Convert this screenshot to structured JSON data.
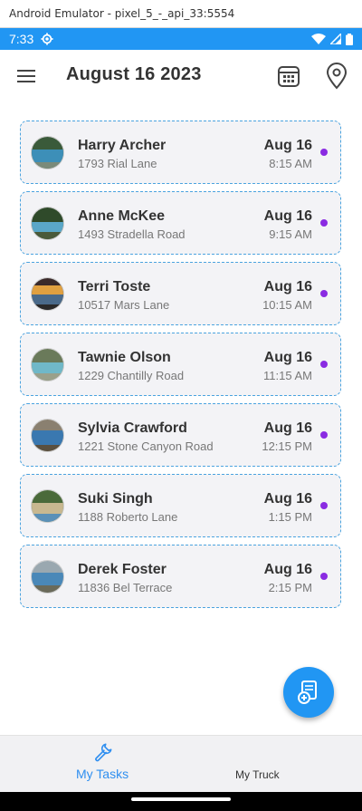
{
  "window": {
    "title": "Android Emulator - pixel_5_-_api_33:5554"
  },
  "status_bar": {
    "time": "7:33",
    "color": "#2196f3"
  },
  "app_bar": {
    "title": "August 16 2023",
    "icons": [
      "menu-icon",
      "calendar-icon",
      "location-pin-icon"
    ]
  },
  "tasks": [
    {
      "name": "Harry Archer",
      "address": "1793 Rial Lane",
      "date": "Aug 16",
      "time": "8:15 AM"
    },
    {
      "name": "Anne McKee",
      "address": "1493 Stradella Road",
      "date": "Aug 16",
      "time": "9:15 AM"
    },
    {
      "name": "Terri Toste",
      "address": "10517 Mars Lane",
      "date": "Aug 16",
      "time": "10:15 AM"
    },
    {
      "name": "Tawnie Olson",
      "address": "1229 Chantilly Road",
      "date": "Aug 16",
      "time": "11:15 AM"
    },
    {
      "name": "Sylvia Crawford",
      "address": "1221 Stone Canyon Road",
      "date": "Aug 16",
      "time": "12:15 PM"
    },
    {
      "name": "Suki Singh",
      "address": "1188 Roberto Lane",
      "date": "Aug 16",
      "time": "1:15 PM"
    },
    {
      "name": "Derek Foster",
      "address": "11836 Bel Terrace",
      "date": "Aug 16",
      "time": "2:15 PM"
    }
  ],
  "status_dot_color": "#8a2be2",
  "fab": {
    "icon": "new-task-icon"
  },
  "bottom_nav": {
    "tabs": [
      {
        "label": "My Tasks",
        "icon": "wrench-icon",
        "active": true
      },
      {
        "label": "My Truck",
        "active": false
      }
    ],
    "active_color": "#2f8ff0"
  }
}
